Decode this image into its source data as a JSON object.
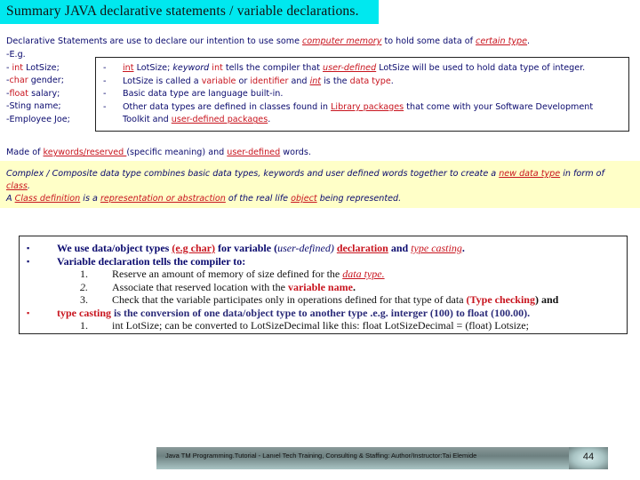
{
  "title": "Summary JAVA declarative statements / variable declarations.",
  "intro": {
    "before": "Declarative Statements are use to declare our intention to use some ",
    "link1": "computer memory",
    "middle": " to hold some data of ",
    "link2": "certain type",
    "after": "."
  },
  "examples": {
    "eg": "-E.g.",
    "items": [
      {
        "prefix": "- ",
        "keyword": "int",
        "rest": "  LotSize;"
      },
      {
        "prefix": "-",
        "keyword": "char",
        "rest": " gender;"
      },
      {
        "prefix": "-",
        "keyword": "float",
        "rest": " salary;"
      },
      {
        "prefix": "-",
        "keyword": "",
        "rest": "Sting name;"
      },
      {
        "prefix": "-",
        "keyword": "",
        "rest": "Employee Joe;"
      }
    ]
  },
  "decl_box": {
    "bullet": "-",
    "row1": {
      "kw": "int",
      "a": " LotSize;   ",
      "italic": "keyword",
      "kw2": " int",
      "b": " tells the compiler that ",
      "ud": "user-defined",
      "c": " LotSize will be used to hold data type of integer."
    },
    "row2": {
      "a": "LotSize is called a ",
      "v": "variable",
      "b": " or ",
      "id": "identifier",
      "c": " and ",
      "int": "int",
      "d": " is the ",
      "dt": "data type",
      "e": "."
    },
    "row3": "Basic data type are language built-in.",
    "row4": {
      "a": "Other data types are defined in classes found in ",
      "lib": " Library packages",
      "b": " that come with your Software Development"
    },
    "row5": {
      "a": "Toolkit and ",
      "udp": " user-defined packages",
      "b": "."
    }
  },
  "made_of": {
    "a": "Made of  ",
    "kw": "keywords/reserved ",
    "b": " (specific meaning)  and ",
    "ud": "user-defined",
    "c": " words."
  },
  "complex": {
    "line1_a": "Complex / Composite data type combines basic data types, keywords and user defined words together to create a ",
    "line1_link": "new data type",
    "line1_b": " in form of",
    "line2_link": "class",
    "line2_b": ".",
    "line3_a": "A ",
    "line3_link1": "Class definition",
    "line3_b": " is a ",
    "line3_link2": "representation or abstraction",
    "line3_c": " of the real life ",
    "line3_link3": "object",
    "line3_d": " being represented."
  },
  "main_box": {
    "bullet_glyph": "▪",
    "b1": {
      "a": "We use data/object  types ",
      "eg": "(e.g char)",
      "b": " for variable (",
      "ud": "user-defined)",
      "decl": "declaration",
      "c": " and ",
      "tc": "type casting",
      "d": "."
    },
    "b2": "Variable declaration tells the compiler to:",
    "n1": {
      "num": "1.",
      "a": "Reserve an amount of memory of size defined for the ",
      "dt": "data type."
    },
    "n2": {
      "num": "2.",
      "a": "Associate that reserved location with the ",
      "vn": "variable name",
      "b": "."
    },
    "n3": {
      "num": "3.",
      "a": "Check that the variable participates only in operations defined for that type of data  ",
      "tc": "(Type checking",
      "b": ") and"
    },
    "b3": {
      "tc": "type casting",
      "a": "  is the conversion of one data/object type to another type .e.g. interger (100) to float (100.00)."
    },
    "n4": {
      "num": "1.",
      "a": "int LotSize; can be converted to LotSizeDecimal like this:  float LotSizeDecimal = (float) Lotsize;"
    }
  },
  "footer": {
    "text": "Java TM Programming.Tutorial -  Lanıel Tech Training, Consulting & Staffing: Author/Instructor:Tai Elemide",
    "page": "44"
  }
}
